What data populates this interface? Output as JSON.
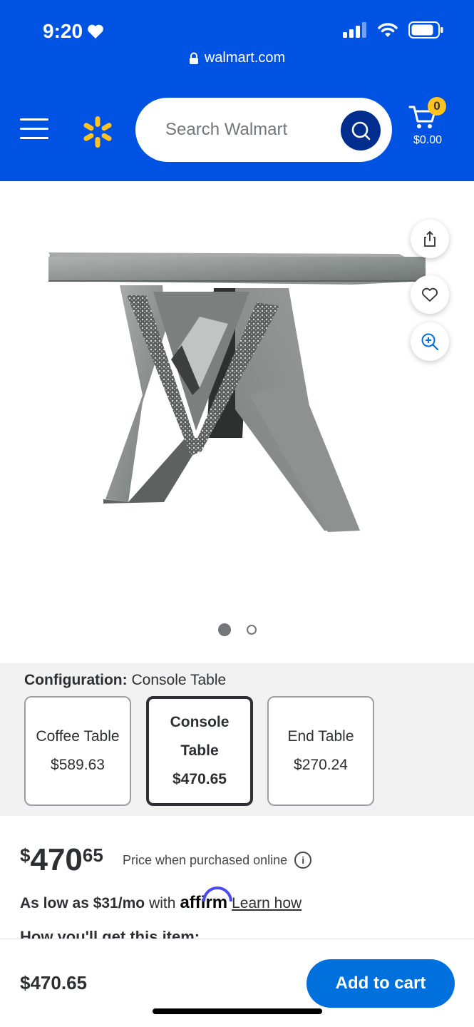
{
  "status": {
    "time": "9:20",
    "url": "walmart.com"
  },
  "header": {
    "search_placeholder": "Search Walmart",
    "cart_count": "0",
    "cart_total": "$0.00"
  },
  "product": {
    "image_index": 1,
    "image_count": 2
  },
  "configuration": {
    "label": "Configuration:",
    "selected": "Console Table",
    "options": [
      {
        "name": "Coffee Table",
        "price": "$589.63"
      },
      {
        "name": "Console Table",
        "name_line1": "Console",
        "name_line2": "Table",
        "price": "$470.65"
      },
      {
        "name": "End Table",
        "price": "$270.24"
      }
    ]
  },
  "price": {
    "currency": "$",
    "dollars": "470",
    "cents": "65",
    "note": "Price when purchased online"
  },
  "affirm": {
    "prefix": "As low as $31/mo",
    "with": "with",
    "brand": "affirm",
    "link": "Learn how"
  },
  "delivery_heading": "How you'll get this item:",
  "bottom": {
    "price": "$470.65",
    "add_to_cart": "Add to cart"
  },
  "colors": {
    "brand_blue": "#0053e2",
    "spark_yellow": "#ffc220",
    "cta_blue": "#0071dc"
  }
}
